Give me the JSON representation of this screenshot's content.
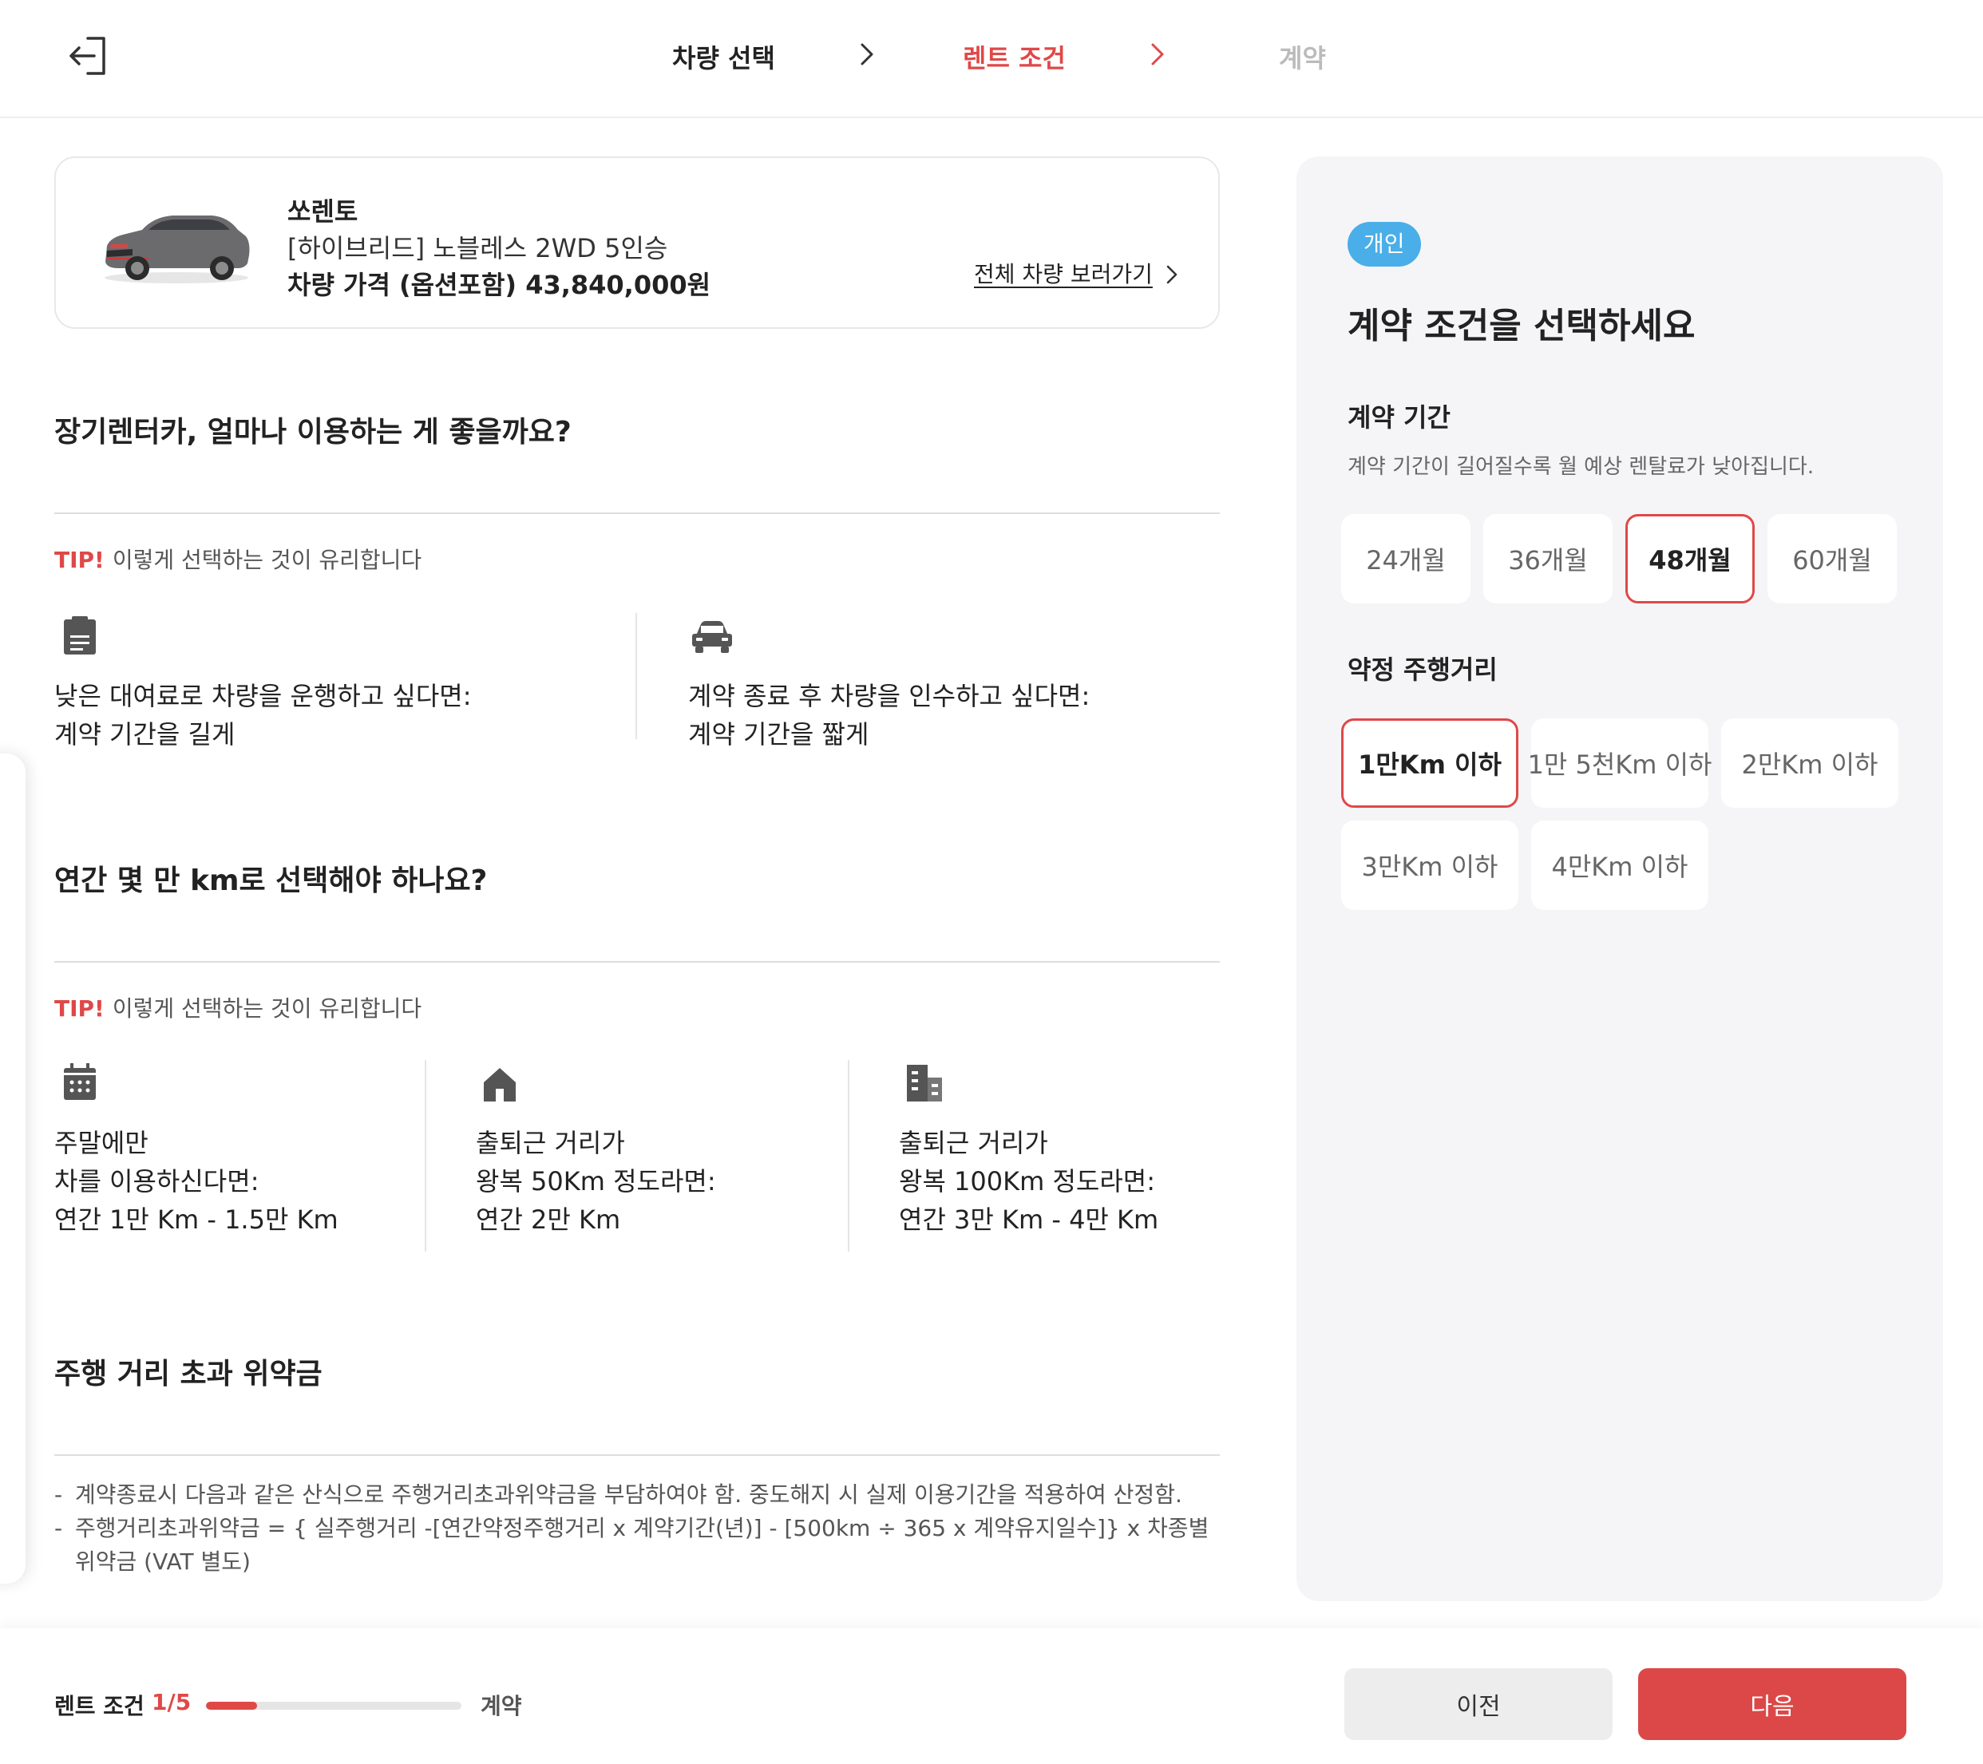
{
  "header": {
    "steps": [
      {
        "label": "차량 선택",
        "state": "done"
      },
      {
        "label": "렌트 조건",
        "state": "active"
      },
      {
        "label": "계약",
        "state": "todo"
      }
    ]
  },
  "car": {
    "name": "쏘렌토",
    "trim": "[하이브리드] 노블레스 2WD 5인승",
    "price": "차량 가격 (옵션포함) 43,840,000원",
    "all_cars_link": "전체 차량 보러가기"
  },
  "section_period": {
    "title": "장기렌터카, 얼마나 이용하는 게 좋을까요?",
    "tip_mark": "TIP!",
    "tip_text": "이렇게 선택하는 것이 유리합니다",
    "items": [
      {
        "icon": "clipboard-icon",
        "line1": "낮은 대여료로 차량을 운행하고 싶다면:",
        "line2": "계약 기간을 길게"
      },
      {
        "icon": "car-icon",
        "line1": "계약 종료 후 차량을 인수하고 싶다면:",
        "line2": "계약 기간을 짧게"
      }
    ]
  },
  "section_mileage": {
    "title": "연간 몇 만 km로 선택해야 하나요?",
    "tip_mark": "TIP!",
    "tip_text": "이렇게 선택하는 것이 유리합니다",
    "items": [
      {
        "icon": "calendar-icon",
        "line1": "주말에만",
        "line2": "차를 이용하신다면:",
        "line3": "연간 1만 Km - 1.5만 Km"
      },
      {
        "icon": "house-icon",
        "line1": "출퇴근 거리가",
        "line2": "왕복 50Km 정도라면:",
        "line3": "연간 2만 Km"
      },
      {
        "icon": "building-icon",
        "line1": "출퇴근 거리가",
        "line2": "왕복 100Km 정도라면:",
        "line3": "연간 3만 Km - 4만 Km"
      }
    ]
  },
  "section_penalty": {
    "title": "주행 거리 초과 위약금",
    "lines": [
      "계약종료시 다음과 같은 산식으로 주행거리초과위약금을 부담하여야 함. 중도해지 시 실제 이용기간을 적용하여 산정함.",
      "주행거리초과위약금 = { 실주행거리 -[연간약정주행거리 x 계약기간(년)] - [500km ÷ 365 x 계약유지일수]} x 차종별 위약금 (VAT 별도)"
    ]
  },
  "panel": {
    "badge": "개인",
    "title": "계약 조건을 선택하세요",
    "period_label": "계약 기간",
    "period_desc": "계약 기간이 길어질수록 월 예상 렌탈료가 낮아집니다.",
    "period_options": [
      "24개월",
      "36개월",
      "48개월",
      "60개월"
    ],
    "period_selected": "48개월",
    "mileage_label": "약정 주행거리",
    "mileage_options": [
      "1만Km 이하",
      "1만 5천Km 이하",
      "2만Km 이하",
      "3만Km 이하",
      "4만Km 이하"
    ],
    "mileage_selected": "1만Km 이하"
  },
  "footer": {
    "progress_label": "렌트 조건",
    "progress_count": "1/5",
    "progress_fraction": 0.2,
    "next_step_label": "계약",
    "prev_button": "이전",
    "next_button": "다음"
  },
  "colors": {
    "accent": "#e04848",
    "badge": "#4aaee8",
    "panel_bg": "#f5f5f7"
  }
}
